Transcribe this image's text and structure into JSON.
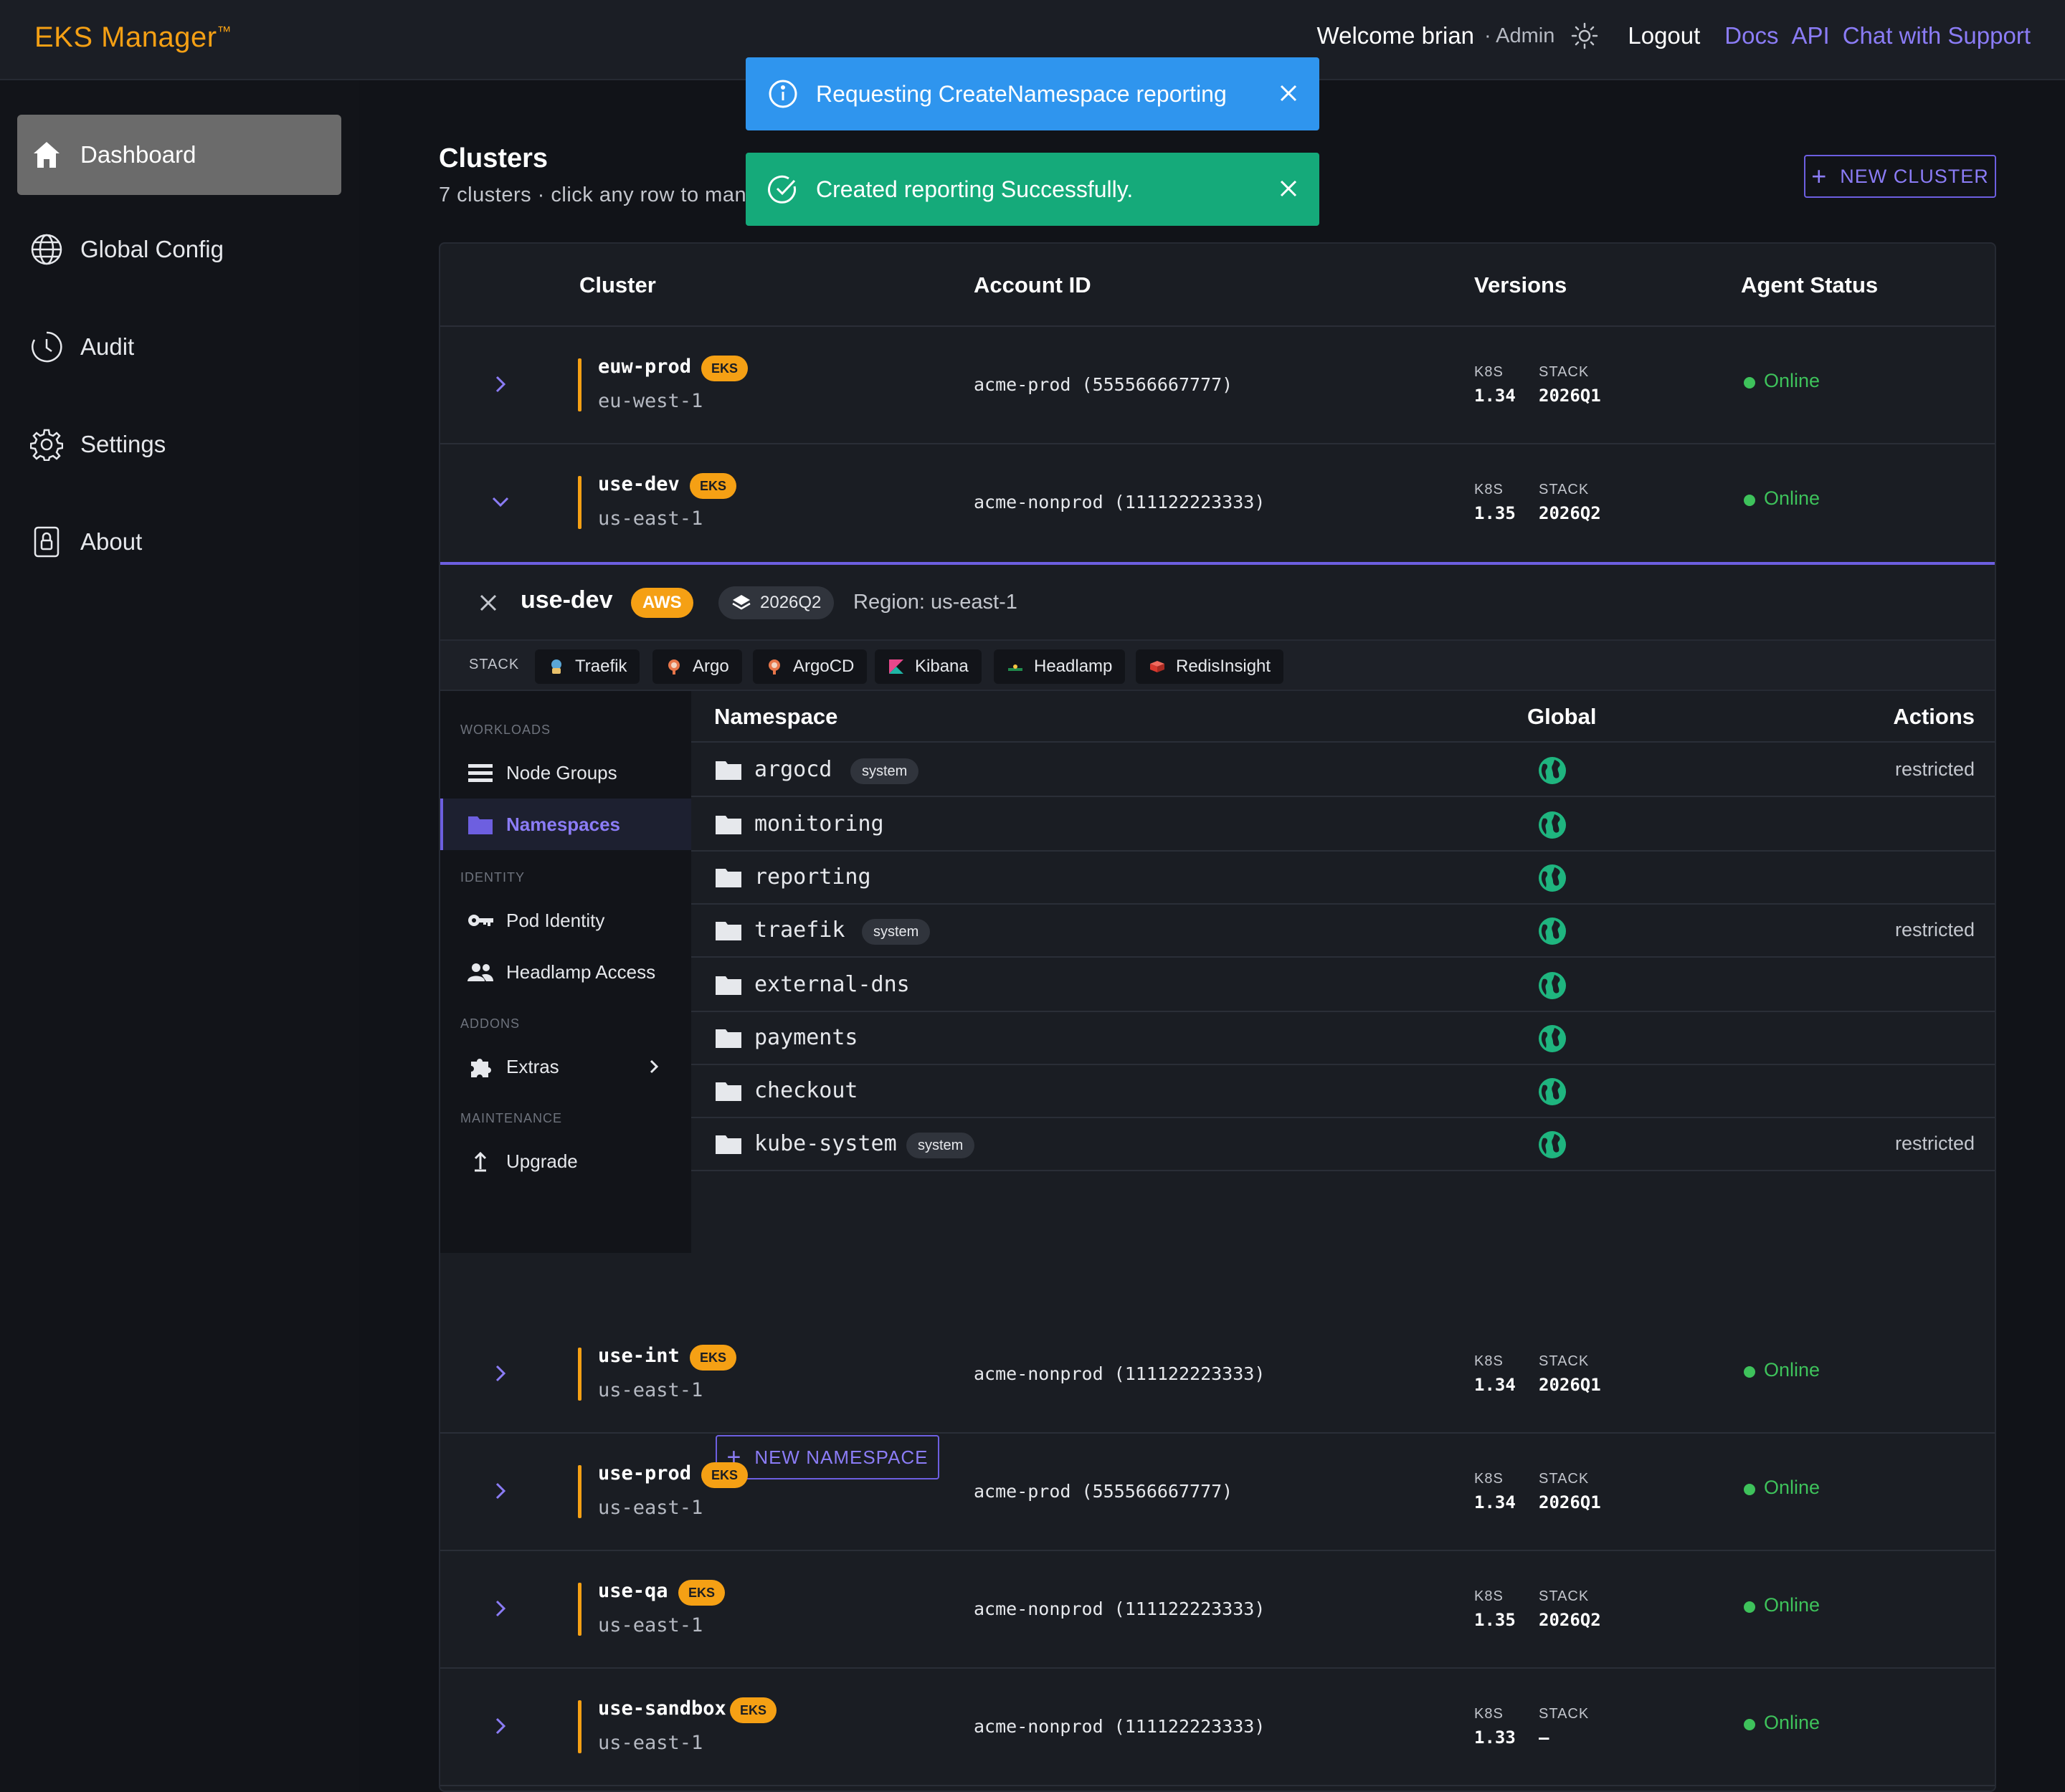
{
  "header": {
    "logo": "EKS Manager",
    "logo_tm": "™",
    "welcome": "Welcome brian",
    "role": "· Admin",
    "logout": "Logout",
    "links": [
      "Docs",
      "API",
      "Chat with Support"
    ]
  },
  "sidebar": {
    "items": [
      {
        "label": "Dashboard",
        "icon": "home-icon"
      },
      {
        "label": "Global Config",
        "icon": "globe-icon"
      },
      {
        "label": "Audit",
        "icon": "clock-icon"
      },
      {
        "label": "Settings",
        "icon": "gear-icon"
      },
      {
        "label": "About",
        "icon": "lock-icon"
      }
    ]
  },
  "toasts": [
    {
      "type": "info",
      "message": "Requesting CreateNamespace reporting",
      "color": "#2f95ee"
    },
    {
      "type": "success",
      "message": "Created reporting Successfully.",
      "color": "#15aa7a"
    }
  ],
  "page": {
    "title": "Clusters",
    "subtitle": "7 clusters · click any row to man",
    "new_cluster": "NEW CLUSTER"
  },
  "table": {
    "columns": [
      "Cluster",
      "Account ID",
      "Versions",
      "Agent Status"
    ],
    "version_labels": {
      "k8s": "K8S",
      "stack": "STACK"
    },
    "rows": [
      {
        "name": "euw-prod",
        "badge": "EKS",
        "region": "eu-west-1",
        "account": "acme-prod (555566667777)",
        "k8s": "1.34",
        "stack": "2026Q1",
        "status": "Online"
      },
      {
        "name": "use-dev",
        "badge": "EKS",
        "region": "us-east-1",
        "account": "acme-nonprod (111122223333)",
        "k8s": "1.35",
        "stack": "2026Q2",
        "status": "Online"
      },
      {
        "name": "use-int",
        "badge": "EKS",
        "region": "us-east-1",
        "account": "acme-nonprod (111122223333)",
        "k8s": "1.34",
        "stack": "2026Q1",
        "status": "Online"
      },
      {
        "name": "use-prod",
        "badge": "EKS",
        "region": "us-east-1",
        "account": "acme-prod (555566667777)",
        "k8s": "1.34",
        "stack": "2026Q1",
        "status": "Online"
      },
      {
        "name": "use-qa",
        "badge": "EKS",
        "region": "us-east-1",
        "account": "acme-nonprod (111122223333)",
        "k8s": "1.35",
        "stack": "2026Q2",
        "status": "Online"
      },
      {
        "name": "use-sandbox",
        "badge": "EKS",
        "region": "us-east-1",
        "account": "acme-nonprod (111122223333)",
        "k8s": "1.33",
        "stack": "–",
        "status": "Online"
      }
    ]
  },
  "detail": {
    "name": "use-dev",
    "provider": "AWS",
    "stack_version": "2026Q2",
    "region": "Region: us-east-1",
    "stack_label": "STACK",
    "stack_apps": [
      {
        "label": "Traefik",
        "color": "#5aa6d6"
      },
      {
        "label": "Argo",
        "color": "#e8764a"
      },
      {
        "label": "ArgoCD",
        "color": "#e8764a"
      },
      {
        "label": "Kibana",
        "color": "#e8478b"
      },
      {
        "label": "Headlamp",
        "color": "#1f8a4c"
      },
      {
        "label": "RedisInsight",
        "color": "#d8382e"
      }
    ],
    "menu": {
      "workloads_label": "WORKLOADS",
      "node_groups": "Node Groups",
      "namespaces": "Namespaces",
      "identity_label": "IDENTITY",
      "pod_identity": "Pod Identity",
      "headlamp_access": "Headlamp Access",
      "addons_label": "ADDONS",
      "extras": "Extras",
      "maintenance_label": "MAINTENANCE",
      "upgrade": "Upgrade"
    },
    "ns_columns": [
      "Namespace",
      "Global",
      "Actions"
    ],
    "namespaces": [
      {
        "name": "argocd",
        "tag": "system",
        "action": "restricted"
      },
      {
        "name": "monitoring",
        "tag": "",
        "action": ""
      },
      {
        "name": "reporting",
        "tag": "",
        "action": ""
      },
      {
        "name": "traefik",
        "tag": "system",
        "action": "restricted"
      },
      {
        "name": "external-dns",
        "tag": "",
        "action": ""
      },
      {
        "name": "payments",
        "tag": "",
        "action": ""
      },
      {
        "name": "checkout",
        "tag": "",
        "action": ""
      },
      {
        "name": "kube-system",
        "tag": "system",
        "action": "restricted"
      }
    ],
    "new_namespace": "NEW NAMESPACE"
  },
  "colors": {
    "accent": "#6d5fe0",
    "brand": "#f5a014",
    "online": "#3ec25b",
    "globe": "#1fb57f"
  }
}
